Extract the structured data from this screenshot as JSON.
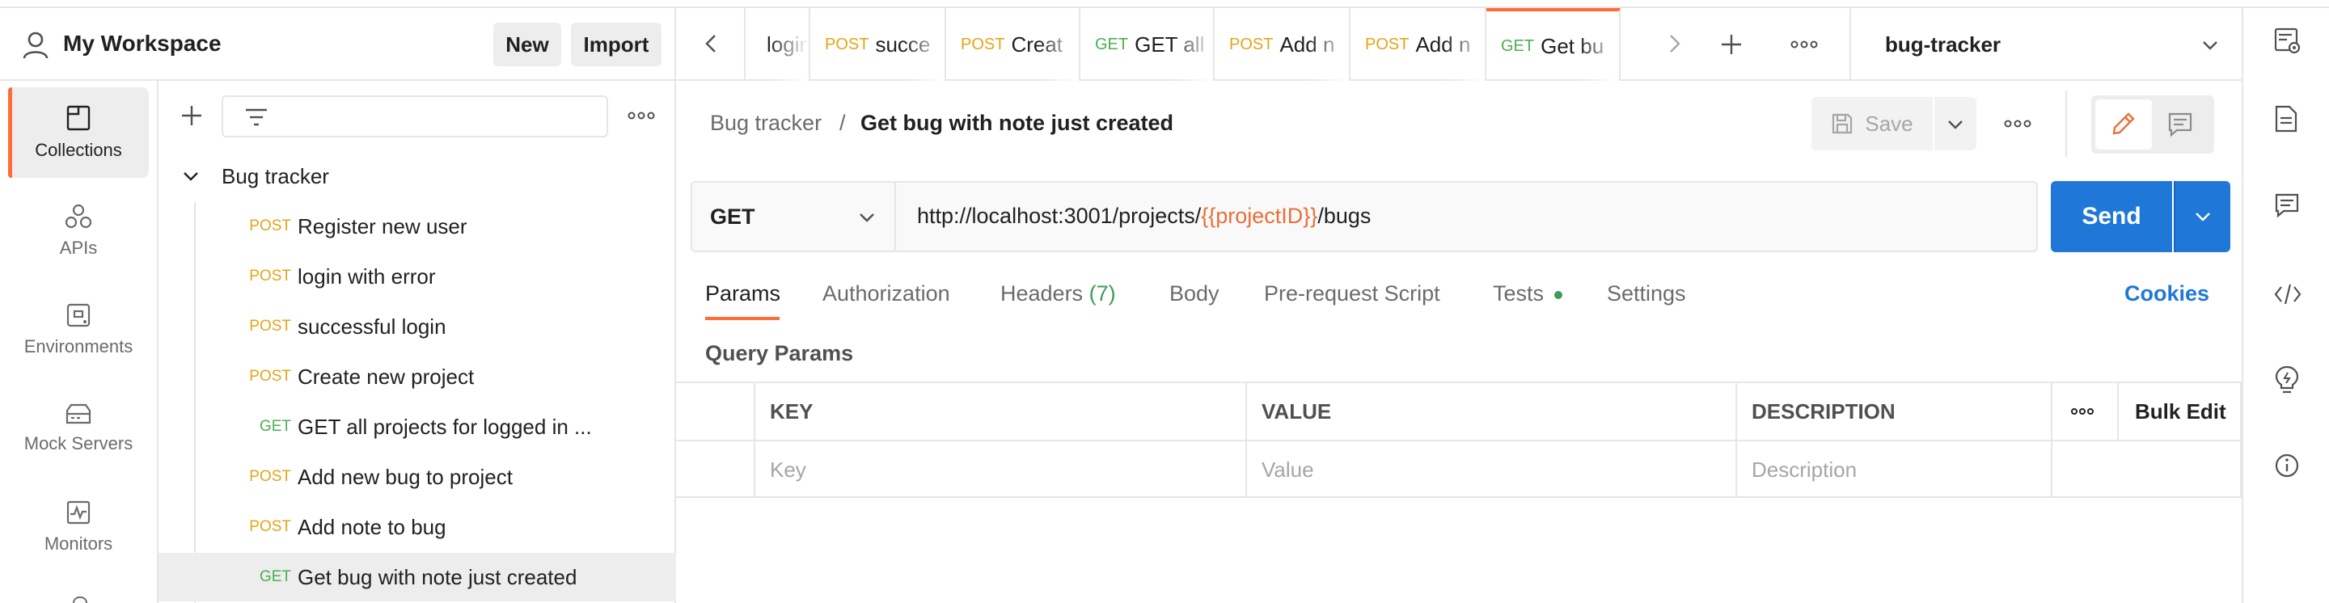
{
  "workspace": {
    "title": "My Workspace",
    "new_label": "New",
    "import_label": "Import"
  },
  "rail": [
    {
      "label": "Collections",
      "icon": "collections-icon",
      "active": true
    },
    {
      "label": "APIs",
      "icon": "apis-icon"
    },
    {
      "label": "Environments",
      "icon": "environments-icon"
    },
    {
      "label": "Mock Servers",
      "icon": "mock-servers-icon"
    },
    {
      "label": "Monitors",
      "icon": "monitors-icon"
    }
  ],
  "collection": {
    "name": "Bug tracker",
    "requests": [
      {
        "method": "POST",
        "name": "Register new user"
      },
      {
        "method": "POST",
        "name": "login with error"
      },
      {
        "method": "POST",
        "name": "successful login"
      },
      {
        "method": "POST",
        "name": "Create new project"
      },
      {
        "method": "GET",
        "name": "GET all projects for logged in ..."
      },
      {
        "method": "POST",
        "name": "Add new bug to project"
      },
      {
        "method": "POST",
        "name": "Add note to bug"
      },
      {
        "method": "GET",
        "name": "Get bug with note just created",
        "active": true
      }
    ]
  },
  "tabs": [
    {
      "method": "",
      "name": "login"
    },
    {
      "method": "POST",
      "name": "succe"
    },
    {
      "method": "POST",
      "name": "Creat"
    },
    {
      "method": "GET",
      "name": "GET all"
    },
    {
      "method": "POST",
      "name": "Add n"
    },
    {
      "method": "POST",
      "name": "Add n"
    },
    {
      "method": "GET",
      "name": "Get bu",
      "active": true
    }
  ],
  "environment": "bug-tracker",
  "breadcrumb": {
    "parent": "Bug tracker",
    "separator": "/",
    "current": "Get bug with note just created"
  },
  "save_label": "Save",
  "request": {
    "method": "GET",
    "url_prefix": "http://localhost:3001/projects/",
    "url_variable": "{{projectID}}",
    "url_suffix": "/bugs"
  },
  "send_label": "Send",
  "request_tabs": {
    "params": "Params",
    "authorization": "Authorization",
    "headers": "Headers",
    "headers_count": "(7)",
    "body": "Body",
    "prerequest": "Pre-request Script",
    "tests": "Tests",
    "settings": "Settings"
  },
  "cookies_label": "Cookies",
  "query_params": {
    "title": "Query Params",
    "columns": {
      "key": "KEY",
      "value": "VALUE",
      "description": "DESCRIPTION"
    },
    "bulk_edit": "Bulk Edit",
    "placeholders": {
      "key": "Key",
      "value": "Value",
      "description": "Description"
    }
  },
  "colors": {
    "accent": "#ff6c37",
    "send": "#1f78d8",
    "post": "#e5a417",
    "get": "#4caf50",
    "variable": "#e8703a"
  }
}
